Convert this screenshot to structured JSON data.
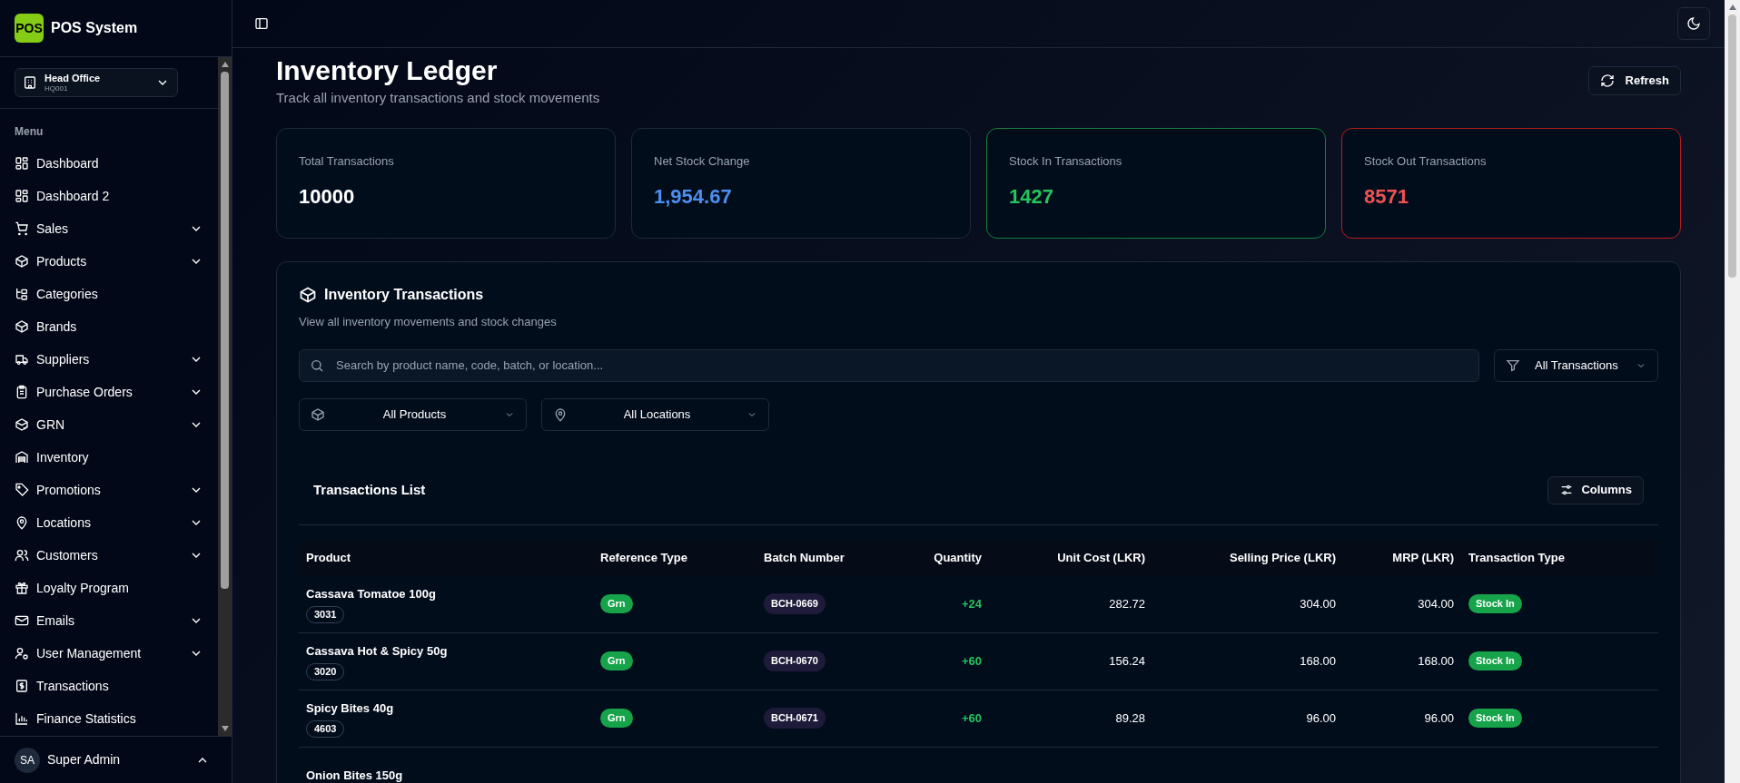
{
  "app": {
    "logo": "POS",
    "name": "POS System"
  },
  "branch": {
    "name": "Head Office",
    "code": "HQ001"
  },
  "sidebar": {
    "section": "Menu",
    "items": [
      {
        "label": "Dashboard",
        "has_submenu": false
      },
      {
        "label": "Dashboard 2",
        "has_submenu": false
      },
      {
        "label": "Sales",
        "has_submenu": true
      },
      {
        "label": "Products",
        "has_submenu": true
      },
      {
        "label": "Categories",
        "has_submenu": false
      },
      {
        "label": "Brands",
        "has_submenu": false
      },
      {
        "label": "Suppliers",
        "has_submenu": true
      },
      {
        "label": "Purchase Orders",
        "has_submenu": true
      },
      {
        "label": "GRN",
        "has_submenu": true
      },
      {
        "label": "Inventory",
        "has_submenu": false
      },
      {
        "label": "Promotions",
        "has_submenu": true
      },
      {
        "label": "Locations",
        "has_submenu": true
      },
      {
        "label": "Customers",
        "has_submenu": true
      },
      {
        "label": "Loyalty Program",
        "has_submenu": false
      },
      {
        "label": "Emails",
        "has_submenu": true
      },
      {
        "label": "User Management",
        "has_submenu": true
      },
      {
        "label": "Transactions",
        "has_submenu": false
      },
      {
        "label": "Finance Statistics",
        "has_submenu": false
      }
    ]
  },
  "user": {
    "initials": "SA",
    "name": "Super Admin"
  },
  "page": {
    "title": "Inventory Ledger",
    "subtitle": "Track all inventory transactions and stock movements",
    "refresh": "Refresh"
  },
  "stats": [
    {
      "label": "Total Transactions",
      "value": "10000",
      "kind": "neutral"
    },
    {
      "label": "Net Stock Change",
      "value": "1,954.67",
      "kind": "info"
    },
    {
      "label": "Stock In Transactions",
      "value": "1427",
      "kind": "positive"
    },
    {
      "label": "Stock Out Transactions",
      "value": "8571",
      "kind": "negative"
    }
  ],
  "panel": {
    "title": "Inventory Transactions",
    "subtitle": "View all inventory movements and stock changes",
    "search": {
      "placeholder": "Search by product name, code, batch, or location..."
    },
    "type_filter": "All Transactions",
    "product_filter": "All Products",
    "location_filter": "All Locations",
    "list_title": "Transactions List",
    "columns_button": "Columns"
  },
  "table": {
    "columns": [
      "Product",
      "Reference Type",
      "Batch Number",
      "Quantity",
      "Unit Cost (LKR)",
      "Selling Price (LKR)",
      "MRP (LKR)",
      "Transaction Type"
    ],
    "rows": [
      {
        "product": "Cassava Tomatoe 100g",
        "code": "3031",
        "reference": "Grn",
        "batch": "BCH-0669",
        "quantity": "+24",
        "unit_cost": "282.72",
        "selling_price": "304.00",
        "mrp": "304.00",
        "type": "Stock In"
      },
      {
        "product": "Cassava Hot & Spicy 50g",
        "code": "3020",
        "reference": "Grn",
        "batch": "BCH-0670",
        "quantity": "+60",
        "unit_cost": "156.24",
        "selling_price": "168.00",
        "mrp": "168.00",
        "type": "Stock In"
      },
      {
        "product": "Spicy Bites 40g",
        "code": "4603",
        "reference": "Grn",
        "batch": "BCH-0671",
        "quantity": "+60",
        "unit_cost": "89.28",
        "selling_price": "96.00",
        "mrp": "96.00",
        "type": "Stock In"
      },
      {
        "product": "Onion Bites 150g"
      }
    ]
  }
}
